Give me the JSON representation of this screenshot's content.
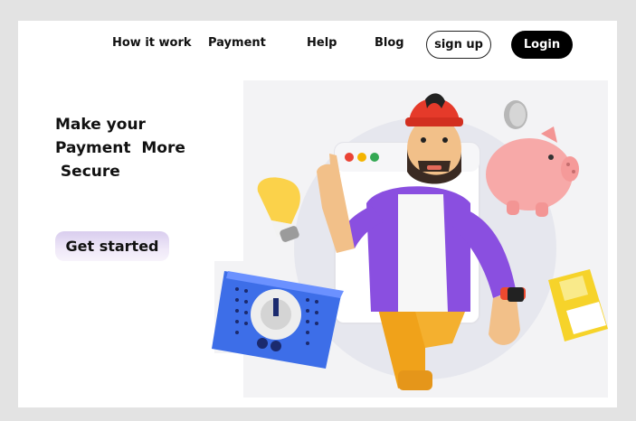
{
  "nav": {
    "links": [
      "How it work",
      "Payment",
      "Help",
      "Blog"
    ],
    "signup_label": "sign up",
    "login_label": "Login"
  },
  "hero": {
    "headline_lines": [
      "Make your",
      "Payment  More",
      " Secure"
    ],
    "cta_label": "Get started"
  },
  "colors": {
    "page_bg": "#e3e3e3",
    "card_bg": "#ffffff",
    "login_bg": "#000000",
    "cta_bg": "#e4dbf3",
    "shirt": "#8a4fe0",
    "hat": "#e53a2a",
    "pants": "#f0a21a"
  },
  "icons": [
    "lightbulb-icon",
    "radio-icon",
    "piggy-bank-icon",
    "coin-icon",
    "floppy-disk-icon",
    "browser-window-icon"
  ]
}
